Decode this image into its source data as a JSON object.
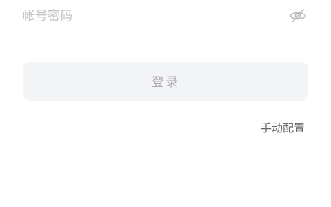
{
  "password": {
    "value": "",
    "placeholder": "帐号密码",
    "visibility_icon": "eye-off-icon"
  },
  "login_button": {
    "label": "登录"
  },
  "manual_config": {
    "label": "手动配置"
  },
  "colors": {
    "placeholder": "#c4c4c4",
    "divider": "#dcdcdc",
    "button_bg": "#f4f5f7",
    "button_text": "#a9a9b0",
    "link_text": "#666666"
  }
}
